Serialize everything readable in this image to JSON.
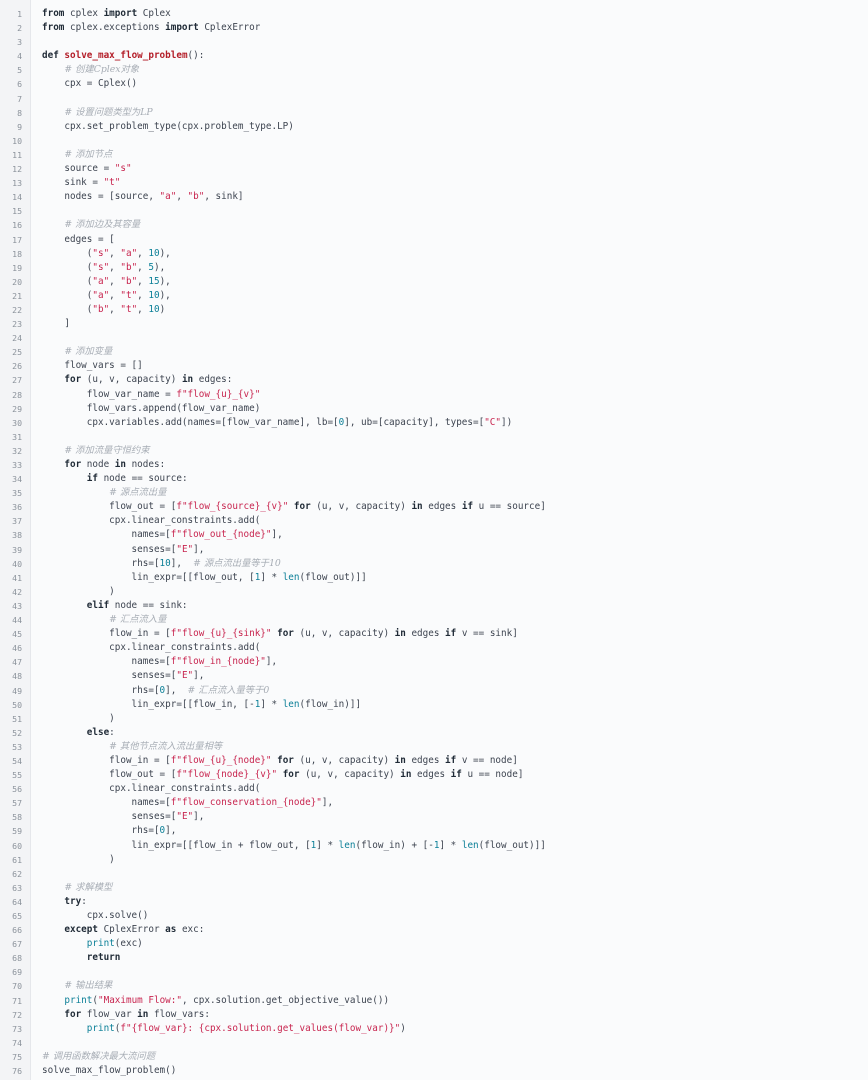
{
  "editor": {
    "language": "python",
    "token_colors": {
      "keyword": "#1f2a36",
      "function_def": "#b31d28",
      "string": "#c8254f",
      "number": "#0b7f97",
      "builtin": "#0b7f97",
      "comment": "#a7adb5",
      "plain": "#3d4450",
      "line_number": "#8b929b",
      "background": "#fafbfc"
    },
    "lines": [
      [
        [
          "kw",
          "from"
        ],
        [
          "p",
          " cplex "
        ],
        [
          "kw",
          "import"
        ],
        [
          "p",
          " Cplex"
        ]
      ],
      [
        [
          "kw",
          "from"
        ],
        [
          "p",
          " cplex.exceptions "
        ],
        [
          "kw",
          "import"
        ],
        [
          "p",
          " CplexError"
        ]
      ],
      [],
      [
        [
          "kw",
          "def"
        ],
        [
          "p",
          " "
        ],
        [
          "fn",
          "solve_max_flow_problem"
        ],
        [
          "p",
          "():"
        ]
      ],
      [
        [
          "p",
          "    "
        ],
        [
          "cm",
          "# 创建Cplex对象"
        ]
      ],
      [
        [
          "p",
          "    cpx = Cplex()"
        ]
      ],
      [],
      [
        [
          "p",
          "    "
        ],
        [
          "cm",
          "# 设置问题类型为LP"
        ]
      ],
      [
        [
          "p",
          "    cpx.set_problem_type(cpx.problem_type.LP)"
        ]
      ],
      [],
      [
        [
          "p",
          "    "
        ],
        [
          "cm",
          "# 添加节点"
        ]
      ],
      [
        [
          "p",
          "    source = "
        ],
        [
          "str",
          "\"s\""
        ]
      ],
      [
        [
          "p",
          "    sink = "
        ],
        [
          "str",
          "\"t\""
        ]
      ],
      [
        [
          "p",
          "    nodes = [source, "
        ],
        [
          "str",
          "\"a\""
        ],
        [
          "p",
          ", "
        ],
        [
          "str",
          "\"b\""
        ],
        [
          "p",
          ", sink]"
        ]
      ],
      [],
      [
        [
          "p",
          "    "
        ],
        [
          "cm",
          "# 添加边及其容量"
        ]
      ],
      [
        [
          "p",
          "    edges = ["
        ]
      ],
      [
        [
          "p",
          "        ("
        ],
        [
          "str",
          "\"s\""
        ],
        [
          "p",
          ", "
        ],
        [
          "str",
          "\"a\""
        ],
        [
          "p",
          ", "
        ],
        [
          "num",
          "10"
        ],
        [
          "p",
          "),"
        ]
      ],
      [
        [
          "p",
          "        ("
        ],
        [
          "str",
          "\"s\""
        ],
        [
          "p",
          ", "
        ],
        [
          "str",
          "\"b\""
        ],
        [
          "p",
          ", "
        ],
        [
          "num",
          "5"
        ],
        [
          "p",
          "),"
        ]
      ],
      [
        [
          "p",
          "        ("
        ],
        [
          "str",
          "\"a\""
        ],
        [
          "p",
          ", "
        ],
        [
          "str",
          "\"b\""
        ],
        [
          "p",
          ", "
        ],
        [
          "num",
          "15"
        ],
        [
          "p",
          "),"
        ]
      ],
      [
        [
          "p",
          "        ("
        ],
        [
          "str",
          "\"a\""
        ],
        [
          "p",
          ", "
        ],
        [
          "str",
          "\"t\""
        ],
        [
          "p",
          ", "
        ],
        [
          "num",
          "10"
        ],
        [
          "p",
          "),"
        ]
      ],
      [
        [
          "p",
          "        ("
        ],
        [
          "str",
          "\"b\""
        ],
        [
          "p",
          ", "
        ],
        [
          "str",
          "\"t\""
        ],
        [
          "p",
          ", "
        ],
        [
          "num",
          "10"
        ],
        [
          "p",
          ")"
        ]
      ],
      [
        [
          "p",
          "    ]"
        ]
      ],
      [],
      [
        [
          "p",
          "    "
        ],
        [
          "cm",
          "# 添加变量"
        ]
      ],
      [
        [
          "p",
          "    flow_vars = []"
        ]
      ],
      [
        [
          "p",
          "    "
        ],
        [
          "kw",
          "for"
        ],
        [
          "p",
          " (u, v, capacity) "
        ],
        [
          "kw",
          "in"
        ],
        [
          "p",
          " edges:"
        ]
      ],
      [
        [
          "p",
          "        flow_var_name = "
        ],
        [
          "str",
          "f\"flow_{u}_{v}\""
        ]
      ],
      [
        [
          "p",
          "        flow_vars.append(flow_var_name)"
        ]
      ],
      [
        [
          "p",
          "        cpx.variables.add(names=[flow_var_name], lb=["
        ],
        [
          "num",
          "0"
        ],
        [
          "p",
          "], ub=[capacity], types=["
        ],
        [
          "str",
          "\"C\""
        ],
        [
          "p",
          "])"
        ]
      ],
      [],
      [
        [
          "p",
          "    "
        ],
        [
          "cm",
          "# 添加流量守恒约束"
        ]
      ],
      [
        [
          "p",
          "    "
        ],
        [
          "kw",
          "for"
        ],
        [
          "p",
          " node "
        ],
        [
          "kw",
          "in"
        ],
        [
          "p",
          " nodes:"
        ]
      ],
      [
        [
          "p",
          "        "
        ],
        [
          "kw",
          "if"
        ],
        [
          "p",
          " node == source:"
        ]
      ],
      [
        [
          "p",
          "            "
        ],
        [
          "cm",
          "# 源点流出量"
        ]
      ],
      [
        [
          "p",
          "            flow_out = ["
        ],
        [
          "str",
          "f\"flow_{source}_{v}\""
        ],
        [
          "p",
          " "
        ],
        [
          "kw",
          "for"
        ],
        [
          "p",
          " (u, v, capacity) "
        ],
        [
          "kw",
          "in"
        ],
        [
          "p",
          " edges "
        ],
        [
          "kw",
          "if"
        ],
        [
          "p",
          " u == source]"
        ]
      ],
      [
        [
          "p",
          "            cpx.linear_constraints.add("
        ]
      ],
      [
        [
          "p",
          "                names=["
        ],
        [
          "str",
          "f\"flow_out_{node}\""
        ],
        [
          "p",
          "],"
        ]
      ],
      [
        [
          "p",
          "                senses=["
        ],
        [
          "str",
          "\"E\""
        ],
        [
          "p",
          "],"
        ]
      ],
      [
        [
          "p",
          "                rhs=["
        ],
        [
          "num",
          "10"
        ],
        [
          "p",
          "],  "
        ],
        [
          "cm",
          "# 源点流出量等于10"
        ]
      ],
      [
        [
          "p",
          "                lin_expr=[[flow_out, ["
        ],
        [
          "num",
          "1"
        ],
        [
          "p",
          "] * "
        ],
        [
          "bi",
          "len"
        ],
        [
          "p",
          "(flow_out)]]"
        ]
      ],
      [
        [
          "p",
          "            )"
        ]
      ],
      [
        [
          "p",
          "        "
        ],
        [
          "kw",
          "elif"
        ],
        [
          "p",
          " node == sink:"
        ]
      ],
      [
        [
          "p",
          "            "
        ],
        [
          "cm",
          "# 汇点流入量"
        ]
      ],
      [
        [
          "p",
          "            flow_in = ["
        ],
        [
          "str",
          "f\"flow_{u}_{sink}\""
        ],
        [
          "p",
          " "
        ],
        [
          "kw",
          "for"
        ],
        [
          "p",
          " (u, v, capacity) "
        ],
        [
          "kw",
          "in"
        ],
        [
          "p",
          " edges "
        ],
        [
          "kw",
          "if"
        ],
        [
          "p",
          " v == sink]"
        ]
      ],
      [
        [
          "p",
          "            cpx.linear_constraints.add("
        ]
      ],
      [
        [
          "p",
          "                names=["
        ],
        [
          "str",
          "f\"flow_in_{node}\""
        ],
        [
          "p",
          "],"
        ]
      ],
      [
        [
          "p",
          "                senses=["
        ],
        [
          "str",
          "\"E\""
        ],
        [
          "p",
          "],"
        ]
      ],
      [
        [
          "p",
          "                rhs=["
        ],
        [
          "num",
          "0"
        ],
        [
          "p",
          "],  "
        ],
        [
          "cm",
          "# 汇点流入量等于0"
        ]
      ],
      [
        [
          "p",
          "                lin_expr=[[flow_in, [-"
        ],
        [
          "num",
          "1"
        ],
        [
          "p",
          "] * "
        ],
        [
          "bi",
          "len"
        ],
        [
          "p",
          "(flow_in)]]"
        ]
      ],
      [
        [
          "p",
          "            )"
        ]
      ],
      [
        [
          "p",
          "        "
        ],
        [
          "kw",
          "else"
        ],
        [
          "p",
          ":"
        ]
      ],
      [
        [
          "p",
          "            "
        ],
        [
          "cm",
          "# 其他节点流入流出量相等"
        ]
      ],
      [
        [
          "p",
          "            flow_in = ["
        ],
        [
          "str",
          "f\"flow_{u}_{node}\""
        ],
        [
          "p",
          " "
        ],
        [
          "kw",
          "for"
        ],
        [
          "p",
          " (u, v, capacity) "
        ],
        [
          "kw",
          "in"
        ],
        [
          "p",
          " edges "
        ],
        [
          "kw",
          "if"
        ],
        [
          "p",
          " v == node]"
        ]
      ],
      [
        [
          "p",
          "            flow_out = ["
        ],
        [
          "str",
          "f\"flow_{node}_{v}\""
        ],
        [
          "p",
          " "
        ],
        [
          "kw",
          "for"
        ],
        [
          "p",
          " (u, v, capacity) "
        ],
        [
          "kw",
          "in"
        ],
        [
          "p",
          " edges "
        ],
        [
          "kw",
          "if"
        ],
        [
          "p",
          " u == node]"
        ]
      ],
      [
        [
          "p",
          "            cpx.linear_constraints.add("
        ]
      ],
      [
        [
          "p",
          "                names=["
        ],
        [
          "str",
          "f\"flow_conservation_{node}\""
        ],
        [
          "p",
          "],"
        ]
      ],
      [
        [
          "p",
          "                senses=["
        ],
        [
          "str",
          "\"E\""
        ],
        [
          "p",
          "],"
        ]
      ],
      [
        [
          "p",
          "                rhs=["
        ],
        [
          "num",
          "0"
        ],
        [
          "p",
          "],"
        ]
      ],
      [
        [
          "p",
          "                lin_expr=[[flow_in + flow_out, ["
        ],
        [
          "num",
          "1"
        ],
        [
          "p",
          "] * "
        ],
        [
          "bi",
          "len"
        ],
        [
          "p",
          "(flow_in) + [-"
        ],
        [
          "num",
          "1"
        ],
        [
          "p",
          "] * "
        ],
        [
          "bi",
          "len"
        ],
        [
          "p",
          "(flow_out)]]"
        ]
      ],
      [
        [
          "p",
          "            )"
        ]
      ],
      [],
      [
        [
          "p",
          "    "
        ],
        [
          "cm",
          "# 求解模型"
        ]
      ],
      [
        [
          "p",
          "    "
        ],
        [
          "kw",
          "try"
        ],
        [
          "p",
          ":"
        ]
      ],
      [
        [
          "p",
          "        cpx.solve()"
        ]
      ],
      [
        [
          "p",
          "    "
        ],
        [
          "kw",
          "except"
        ],
        [
          "p",
          " CplexError "
        ],
        [
          "kw",
          "as"
        ],
        [
          "p",
          " exc:"
        ]
      ],
      [
        [
          "p",
          "        "
        ],
        [
          "bi",
          "print"
        ],
        [
          "p",
          "(exc)"
        ]
      ],
      [
        [
          "p",
          "        "
        ],
        [
          "kw",
          "return"
        ]
      ],
      [],
      [
        [
          "p",
          "    "
        ],
        [
          "cm",
          "# 输出结果"
        ]
      ],
      [
        [
          "p",
          "    "
        ],
        [
          "bi",
          "print"
        ],
        [
          "p",
          "("
        ],
        [
          "str",
          "\"Maximum Flow:\""
        ],
        [
          "p",
          ", cpx.solution.get_objective_value())"
        ]
      ],
      [
        [
          "p",
          "    "
        ],
        [
          "kw",
          "for"
        ],
        [
          "p",
          " flow_var "
        ],
        [
          "kw",
          "in"
        ],
        [
          "p",
          " flow_vars:"
        ]
      ],
      [
        [
          "p",
          "        "
        ],
        [
          "bi",
          "print"
        ],
        [
          "p",
          "("
        ],
        [
          "str",
          "f\"{flow_var}: {cpx.solution.get_values(flow_var)}\""
        ],
        [
          "p",
          ")"
        ]
      ],
      [],
      [
        [
          "cm",
          "# 调用函数解决最大流问题"
        ]
      ],
      [
        [
          "p",
          "solve_max_flow_problem()"
        ]
      ]
    ]
  }
}
